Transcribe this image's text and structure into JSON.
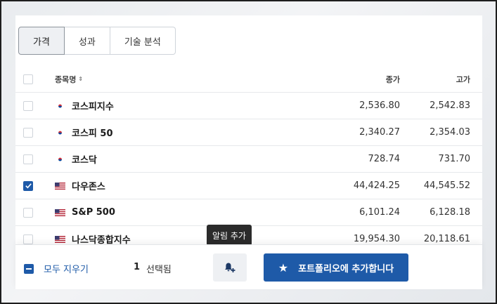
{
  "tabs": [
    {
      "label": "가격",
      "active": true
    },
    {
      "label": "성과",
      "active": false
    },
    {
      "label": "기술 분석",
      "active": false
    }
  ],
  "table": {
    "headers": {
      "name": "종목명",
      "close": "종가",
      "high": "고가"
    },
    "rows": [
      {
        "flag": "kr",
        "name": "코스피지수",
        "close": "2,536.80",
        "high": "2,542.83",
        "checked": false
      },
      {
        "flag": "kr",
        "name": "코스피 50",
        "close": "2,340.27",
        "high": "2,354.03",
        "checked": false
      },
      {
        "flag": "kr",
        "name": "코스닥",
        "close": "728.74",
        "high": "731.70",
        "checked": false
      },
      {
        "flag": "us",
        "name": "다우존스",
        "close": "44,424.25",
        "high": "44,545.52",
        "checked": true
      },
      {
        "flag": "us",
        "name": "S&P 500",
        "close": "6,101.24",
        "high": "6,128.18",
        "checked": false
      },
      {
        "flag": "us",
        "name": "나스닥종합지수",
        "close": "19,954.30",
        "high": "20,118.61",
        "checked": false
      }
    ]
  },
  "bottom": {
    "clear_label": "모두 지우기",
    "selected_count": "1",
    "selected_label": "선택됨",
    "alert_tooltip": "알림 추가",
    "add_portfolio_label": "포트폴리오에 추가합니다"
  },
  "colors": {
    "accent": "#1e5aa8"
  }
}
